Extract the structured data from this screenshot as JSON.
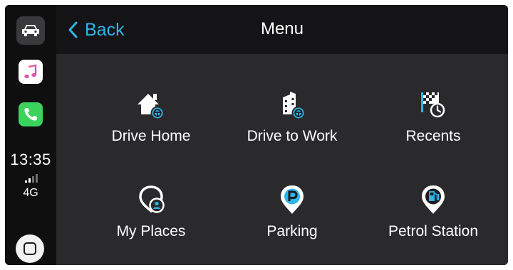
{
  "dock": {
    "apps": [
      {
        "name": "Navigation",
        "icon": "car-icon"
      },
      {
        "name": "Music",
        "icon": "music-note-icon"
      },
      {
        "name": "Phone",
        "icon": "phone-icon"
      }
    ],
    "time": "13:35",
    "network": "4G",
    "signal_bars": 2
  },
  "header": {
    "back_label": "Back",
    "title": "Menu"
  },
  "menu": {
    "items": [
      {
        "label": "Drive Home",
        "icon": "house-steering-wheel-icon"
      },
      {
        "label": "Drive to Work",
        "icon": "building-steering-wheel-icon"
      },
      {
        "label": "Recents",
        "icon": "checkered-flag-clock-icon"
      },
      {
        "label": "My Places",
        "icon": "place-pin-person-icon"
      },
      {
        "label": "Parking",
        "icon": "parking-pin-icon"
      },
      {
        "label": "Petrol Station",
        "icon": "fuel-pump-pin-icon"
      }
    ]
  },
  "colors": {
    "accent": "#2fb4e9",
    "header_bg": "#141416",
    "content_bg": "#2a2a2c",
    "text": "#ffffff"
  }
}
